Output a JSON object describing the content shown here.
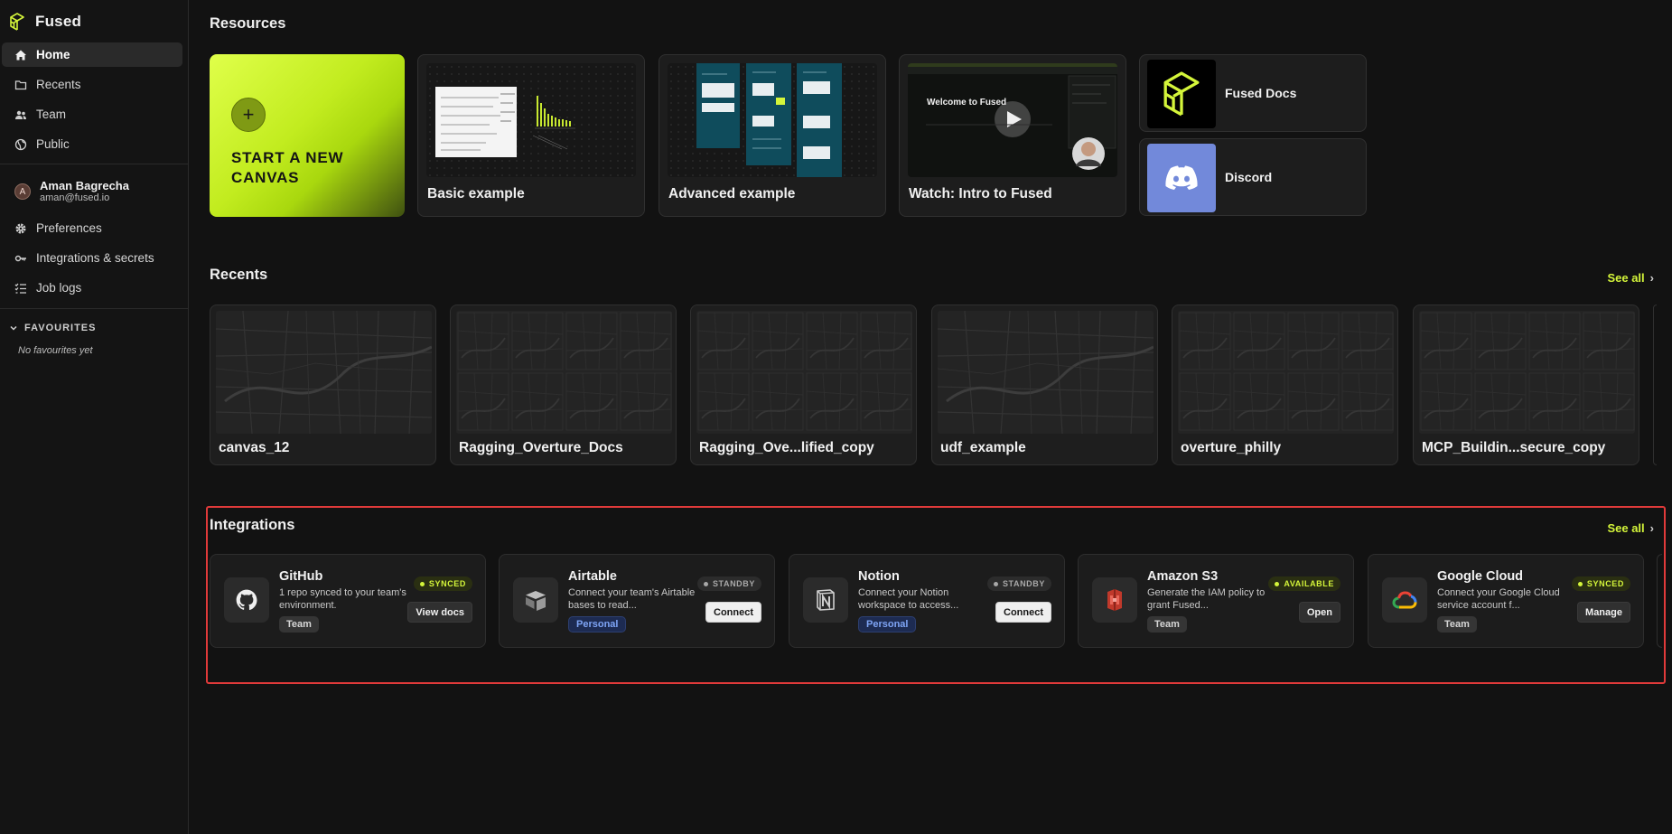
{
  "app": {
    "name": "Fused"
  },
  "sidebar": {
    "nav": [
      {
        "label": "Home",
        "icon": "home-icon",
        "active": true
      },
      {
        "label": "Recents",
        "icon": "folder-icon"
      },
      {
        "label": "Team",
        "icon": "people-icon"
      },
      {
        "label": "Public",
        "icon": "globe-icon"
      }
    ],
    "user": {
      "initial": "A",
      "name": "Aman Bagrecha",
      "email": "aman@fused.io"
    },
    "nav2": [
      {
        "label": "Preferences",
        "icon": "gear-icon"
      },
      {
        "label": "Integrations & secrets",
        "icon": "key-icon"
      },
      {
        "label": "Job logs",
        "icon": "list-check-icon"
      }
    ],
    "favourites": {
      "title": "FAVOURITES",
      "empty": "No favourites yet"
    }
  },
  "resources": {
    "title": "Resources",
    "start": {
      "label": "START A NEW CANVAS",
      "plus": "+"
    },
    "cards": [
      {
        "label": "Basic example"
      },
      {
        "label": "Advanced example"
      },
      {
        "label": "Watch: Intro to Fused",
        "video_title": "Welcome to Fused"
      }
    ],
    "links": [
      {
        "label": "Fused Docs",
        "color": "#000000"
      },
      {
        "label": "Discord",
        "color": "#7289da"
      }
    ]
  },
  "recents": {
    "title": "Recents",
    "see_all": "See all",
    "items": [
      {
        "label": "canvas_12",
        "thumb": "map"
      },
      {
        "label": "Ragging_Overture_Docs",
        "thumb": "grid"
      },
      {
        "label": "Ragging_Ove...lified_copy",
        "thumb": "grid"
      },
      {
        "label": "udf_example",
        "thumb": "map"
      },
      {
        "label": "overture_philly",
        "thumb": "grid"
      },
      {
        "label": "MCP_Buildin...secure_copy",
        "thumb": "grid"
      }
    ]
  },
  "integrations": {
    "title": "Integrations",
    "see_all": "See all",
    "items": [
      {
        "name": "GitHub",
        "icon": "github-icon",
        "desc": "1 repo synced to your team's environment.",
        "tag": "Team",
        "tag_type": "team",
        "status": "SYNCED",
        "status_type": "synced",
        "button": "View docs",
        "button_type": "dark"
      },
      {
        "name": "Airtable",
        "icon": "airtable-icon",
        "desc": "Connect your team's Airtable bases to read...",
        "tag": "Personal",
        "tag_type": "personal",
        "status": "STANDBY",
        "status_type": "standby",
        "button": "Connect",
        "button_type": "light"
      },
      {
        "name": "Notion",
        "icon": "notion-icon",
        "desc": "Connect your Notion workspace to access...",
        "tag": "Personal",
        "tag_type": "personal",
        "status": "STANDBY",
        "status_type": "standby",
        "button": "Connect",
        "button_type": "light"
      },
      {
        "name": "Amazon S3",
        "icon": "s3-icon",
        "desc": "Generate the IAM policy to grant Fused...",
        "tag": "Team",
        "tag_type": "team",
        "status": "AVAILABLE",
        "status_type": "available",
        "button": "Open",
        "button_type": "dark"
      },
      {
        "name": "Google Cloud",
        "icon": "google-cloud-icon",
        "desc": "Connect your Google Cloud service account f...",
        "tag": "Team",
        "tag_type": "team",
        "status": "SYNCED",
        "status_type": "synced",
        "button": "Manage",
        "button_type": "dark"
      }
    ]
  },
  "colors": {
    "accent": "#d4f53a",
    "highlight_box": "#e03a3a",
    "background": "#121212"
  }
}
